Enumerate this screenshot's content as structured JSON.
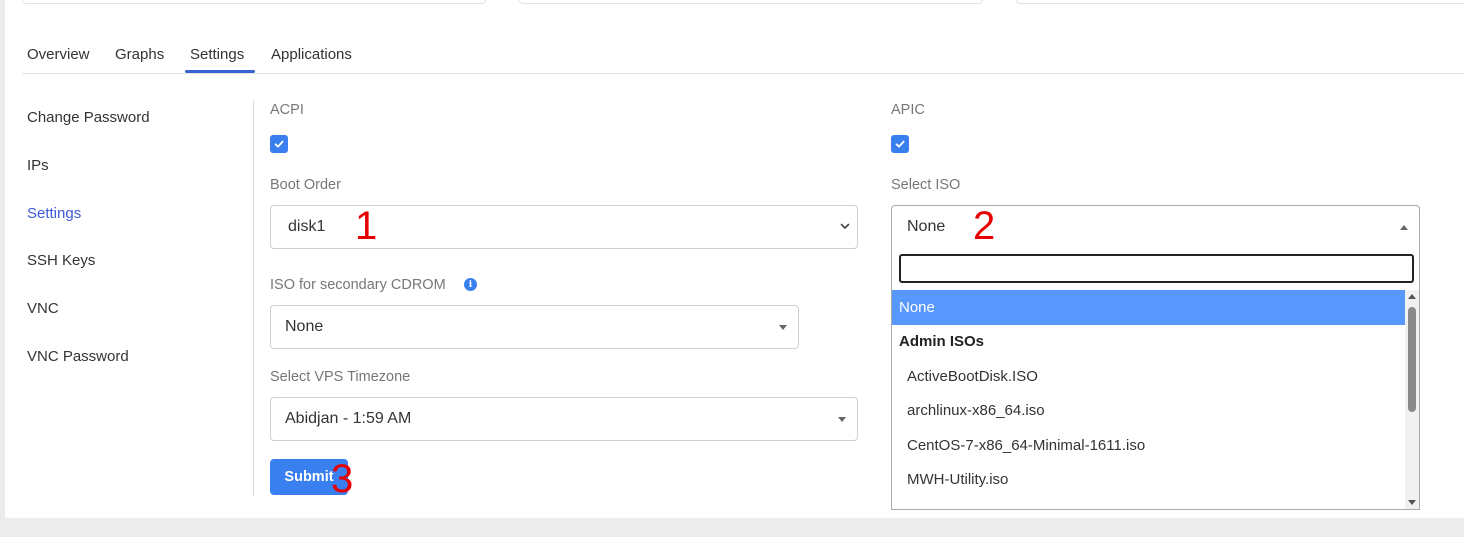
{
  "tabs": [
    "Overview",
    "Graphs",
    "Settings",
    "Applications"
  ],
  "sidebar": {
    "items": [
      {
        "label": "Change Password"
      },
      {
        "label": "IPs"
      },
      {
        "label": "Settings"
      },
      {
        "label": "SSH Keys"
      },
      {
        "label": "VNC"
      },
      {
        "label": "VNC Password"
      }
    ],
    "active": "Settings"
  },
  "form": {
    "acpi_label": "ACPI",
    "acpi_checked": true,
    "apic_label": "APIC",
    "apic_checked": true,
    "boot_order_label": "Boot Order",
    "boot_order_value": "disk1",
    "select_iso_label": "Select ISO",
    "select_iso_value": "None",
    "secondary_cdrom_label": "ISO for secondary CDROM",
    "secondary_cdrom_value": "None",
    "timezone_label": "Select VPS Timezone",
    "timezone_value": "Abidjan - 1:59 AM",
    "submit_label": "Submit"
  },
  "iso_dropdown": {
    "search_value": "",
    "options": [
      {
        "label": "None",
        "type": "selected"
      },
      {
        "label": "Admin ISOs",
        "type": "group"
      },
      {
        "label": "ActiveBootDisk.ISO",
        "type": "child"
      },
      {
        "label": "archlinux-x86_64.iso",
        "type": "child"
      },
      {
        "label": "CentOS-7-x86_64-Minimal-1611.iso",
        "type": "child"
      },
      {
        "label": "MWH-Utility.iso",
        "type": "child"
      }
    ]
  },
  "annotations": [
    "1",
    "2",
    "3"
  ],
  "colors": {
    "accent": "#3a7ff0",
    "active_link": "#3b5bd6",
    "highlight": "#5897fb",
    "annotation": "#e60000"
  }
}
